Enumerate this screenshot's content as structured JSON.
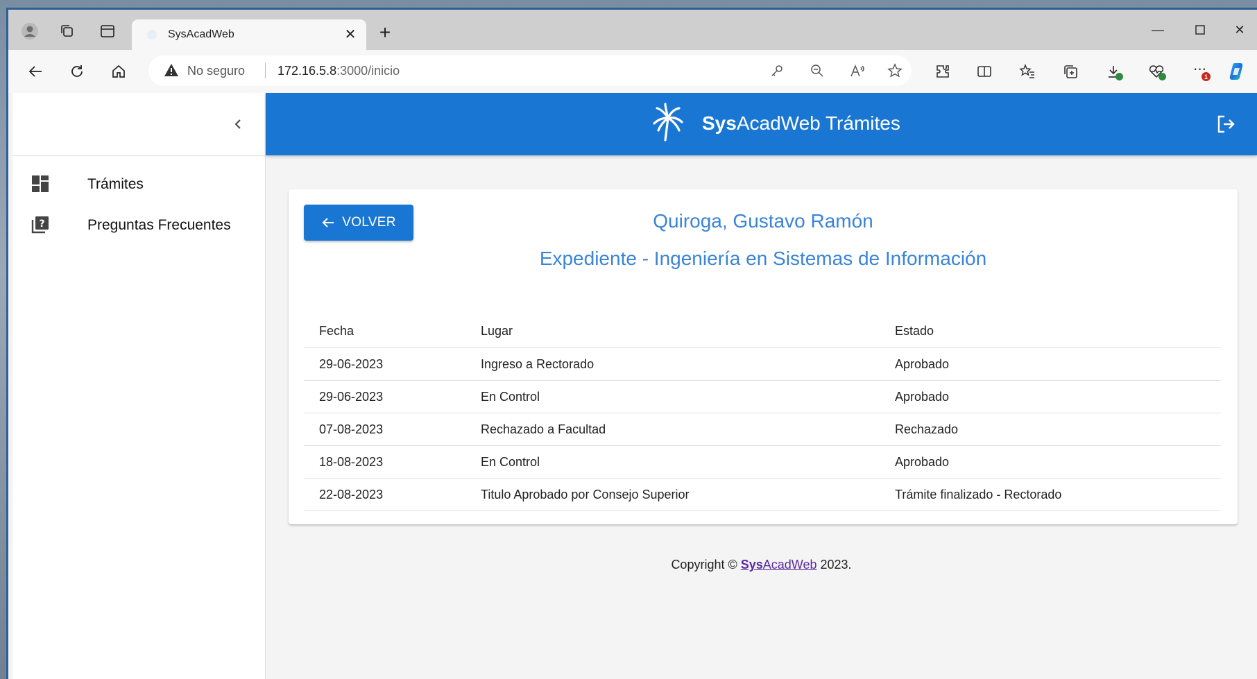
{
  "browser": {
    "tab_title": "SysAcadWeb",
    "omnibox": {
      "security_label": "No seguro",
      "url_host": "172.16.5.8",
      "url_path": ":3000/inicio"
    },
    "icons": [
      "profile-icon",
      "workspaces-icon",
      "vertical-tabs-icon",
      "close-icon",
      "plus-icon",
      "back-icon",
      "reload-icon",
      "home-icon",
      "warning-icon",
      "key-icon",
      "zoom-out-icon",
      "read-aloud-icon",
      "favorite-star-icon",
      "extensions-icon",
      "split-screen-icon",
      "favorites-icon",
      "collections-icon",
      "downloads-icon",
      "browser-essentials-icon",
      "more-icon",
      "copilot-icon"
    ],
    "more_badge": "1"
  },
  "sidebar": {
    "items": [
      {
        "label": "Trámites",
        "icon": "dashboard-icon"
      },
      {
        "label": "Preguntas Frecuentes",
        "icon": "faq-icon"
      }
    ]
  },
  "appbar": {
    "title_bold": "Sys",
    "title_rest": "AcadWeb Trámites",
    "brand_color": "#1976d2"
  },
  "card": {
    "back_label": "VOLVER",
    "student_name": "Quiroga, Gustavo Ramón",
    "record_title": "Expediente - Ingeniería en Sistemas de Información",
    "table": {
      "headers": [
        "Fecha",
        "Lugar",
        "Estado"
      ],
      "rows": [
        [
          "29-06-2023",
          "Ingreso a Rectorado",
          "Aprobado"
        ],
        [
          "29-06-2023",
          "En Control",
          "Aprobado"
        ],
        [
          "07-08-2023",
          "Rechazado a Facultad",
          "Rechazado"
        ],
        [
          "18-08-2023",
          "En Control",
          "Aprobado"
        ],
        [
          "22-08-2023",
          "Titulo Aprobado por Consejo Superior",
          "Trámite finalizado - Rectorado"
        ]
      ]
    }
  },
  "footer": {
    "prefix": "Copyright © ",
    "link_bold": "Sys",
    "link_rest": "AcadWeb",
    "suffix": " 2023."
  }
}
